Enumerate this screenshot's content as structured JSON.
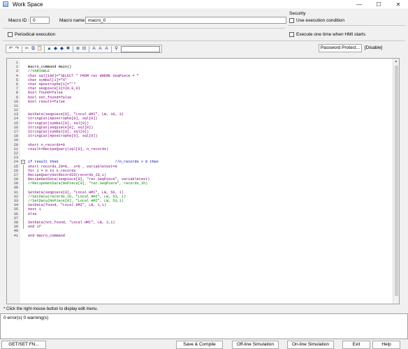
{
  "window": {
    "title": "Work Space",
    "minimize": "—",
    "maximize": "☐",
    "close": "✕"
  },
  "props": {
    "macro_id_label": "Macro ID :",
    "macro_id_value": "0",
    "macro_name_label": "Macro name :",
    "macro_name_value": "macro_0",
    "security_label": "Security",
    "use_exec_condition": "Use execution condition",
    "periodical_execution": "Periodical execution",
    "execute_once": "Execute one time when HMI starts"
  },
  "toolbar": {
    "icons": [
      {
        "name": "undo-icon",
        "glyph": "↶"
      },
      {
        "name": "redo-icon",
        "glyph": "↷"
      },
      {
        "sep": true
      },
      {
        "name": "cut-icon",
        "glyph": "✂"
      },
      {
        "name": "copy-icon",
        "glyph": "⧉"
      },
      {
        "name": "paste-icon",
        "glyph": "📋"
      },
      {
        "sep": true
      },
      {
        "name": "toggle-bookmark-icon",
        "glyph": "▲"
      },
      {
        "name": "prev-bookmark-icon",
        "glyph": "◆"
      },
      {
        "name": "next-bookmark-icon",
        "glyph": "◆"
      },
      {
        "name": "clear-bookmarks-icon",
        "glyph": "✖"
      },
      {
        "sep": true
      },
      {
        "name": "list-icon",
        "glyph": "≣"
      },
      {
        "name": "collapse-icon",
        "glyph": "⊟"
      },
      {
        "sep": true
      },
      {
        "name": "font-increase-icon",
        "glyph": "A"
      },
      {
        "name": "font-decrease-icon",
        "glyph": "A"
      },
      {
        "name": "font-style-icon",
        "glyph": "A"
      },
      {
        "sep": true
      },
      {
        "name": "find-icon",
        "glyph": "⚲"
      }
    ],
    "password_button": "Password Protect...",
    "disabled_label": "[Disable]"
  },
  "editor": {
    "lines": [
      {
        "n": "1",
        "text": ""
      },
      {
        "n": "2",
        "text": "macro_command main()"
      },
      {
        "n": "3",
        "text": "//VARIABLE",
        "color": "#008000"
      },
      {
        "n": "4",
        "text": "char sql[100]=\"SELECT * FROM rec WHERE SeqPiece = \"",
        "color": "#800080"
      },
      {
        "n": "5",
        "text": "char symbal[1]=\"%\"",
        "color": "#800080"
      },
      {
        "n": "6",
        "text": "char Apostrophe[1]=\"'\"",
        "color": "#800080"
      },
      {
        "n": "7",
        "text": "char seqpiece[3]={0,0,0}",
        "color": "#800080"
      },
      {
        "n": "8",
        "text": "bool found=false",
        "color": "#800080"
      },
      {
        "n": "9",
        "text": "bool not_found=false",
        "color": "#800080"
      },
      {
        "n": "10",
        "text": "bool result=false",
        "color": "#800080"
      },
      {
        "n": "11",
        "text": ""
      },
      {
        "n": "12",
        "text": ""
      },
      {
        "n": "13",
        "text": "GetData(seqpiece[0], \"Local HMI\", LW, 10, 3)",
        "color": "#800080"
      },
      {
        "n": "14",
        "text": "StringCat(Apostrophe[0], sql[0])",
        "color": "#800080"
      },
      {
        "n": "15",
        "text": "StringCat(symbal[0], sql[0])",
        "color": "#800080"
      },
      {
        "n": "16",
        "text": "StringCat(seqpiece[0], sql[0])",
        "color": "#800080"
      },
      {
        "n": "17",
        "text": "StringCat(symbal[0], sql[0])",
        "color": "#800080"
      },
      {
        "n": "18",
        "text": "StringCat(Apostrophe[0], sql[0])",
        "color": "#800080"
      },
      {
        "n": "19",
        "text": ""
      },
      {
        "n": "20",
        "text": "short n_records=0",
        "color": "#800080"
      },
      {
        "n": "21",
        "text": "result=RecipeQuery(sql[0], n_records)",
        "color": "#800080"
      },
      {
        "n": "22",
        "text": ""
      },
      {
        "n": "23",
        "text": ""
      },
      {
        "n": "24",
        "text": "if result then                          //n_records > 0 then",
        "color": "#0000c0",
        "fold": "box"
      },
      {
        "n": "25",
        "text": "short records_ID=0,  i=0 , variabletest=0",
        "color": "#800080",
        "fold": "line"
      },
      {
        "n": "26",
        "text": "for i = 0 to n_records",
        "color": "#800080",
        "fold": "line"
      },
      {
        "n": "27",
        "text": "RecipeQueryGetRecordID(records_ID,i)",
        "color": "#800080",
        "fold": "line"
      },
      {
        "n": "28",
        "text": "RecipeGetData(seqpiece[0], \"rec.SeqPiece\", variabletest)",
        "color": "#800080",
        "fold": "line"
      },
      {
        "n": "29",
        "text": "//RecipeGetData(NoPiece[0], \"rec.SeqPiece\", records_ID)",
        "color": "#008000",
        "fold": "line"
      },
      {
        "n": "30",
        "text": "",
        "fold": "line"
      },
      {
        "n": "31",
        "text": "SetData(seqpiece[0], \"Local HMI\", LW, 50, 1)",
        "color": "#800080",
        "fold": "line"
      },
      {
        "n": "32",
        "text": "//SetData(records_ID, \"Local HMI\", LW, 53, 1)",
        "color": "#008000",
        "fold": "line"
      },
      {
        "n": "33",
        "text": "//SetData(NoPiece[0], \"Local HMI\", LW, 53,1)",
        "color": "#008000",
        "fold": "line"
      },
      {
        "n": "34",
        "text": "SetData(found, \"Local HMI\", LB, 1,1)",
        "color": "#800080",
        "fold": "line"
      },
      {
        "n": "35",
        "text": "next i",
        "color": "#800080",
        "fold": "line"
      },
      {
        "n": "36",
        "text": "else",
        "color": "#800080",
        "fold": "line"
      },
      {
        "n": "37",
        "text": "",
        "fold": "line"
      },
      {
        "n": "38",
        "text": "SetData(not_found, \"Local HMI\", LB, 2,1)",
        "color": "#800080",
        "fold": "line"
      },
      {
        "n": "39",
        "text": "end if",
        "color": "#800080",
        "fold": "line"
      },
      {
        "n": "40",
        "text": ""
      },
      {
        "n": "41",
        "text": "end macro_command",
        "color": "#800080"
      }
    ]
  },
  "status": {
    "hint": "* Click the right mouse button to display edit menu.",
    "output": "0 error(s) 0 warning(s)"
  },
  "buttons": {
    "getset": "GET/SET FN...",
    "save_compile": "Save & Compile",
    "offline": "Off-line Simulation",
    "online": "On-line Simulation",
    "exit": "Exit",
    "help": "Help"
  }
}
